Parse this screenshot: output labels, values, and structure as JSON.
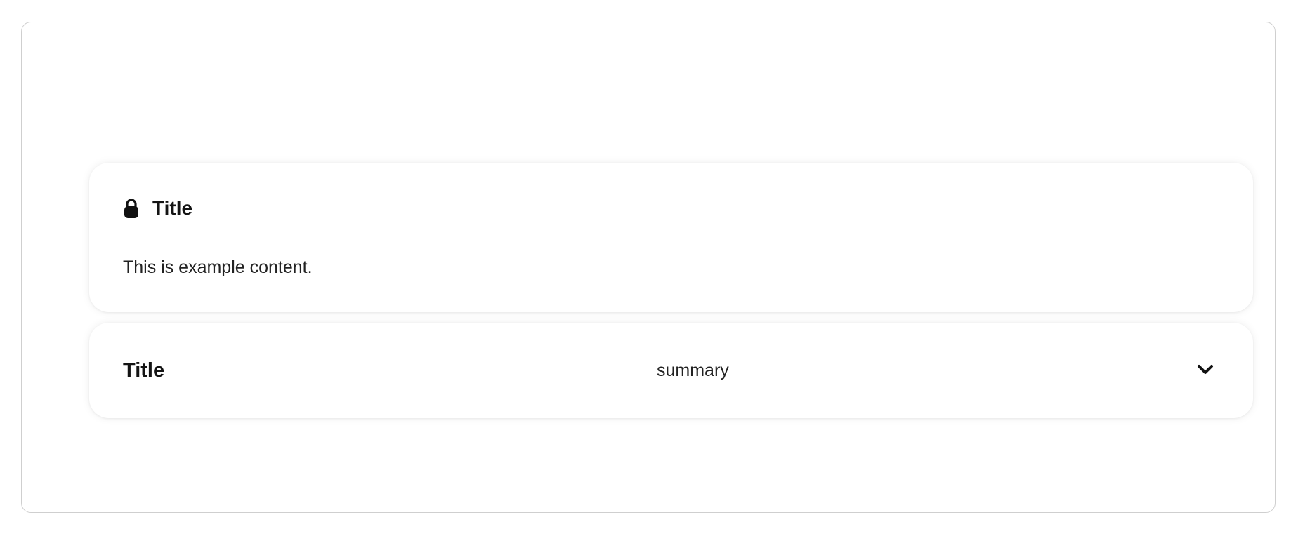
{
  "expanded_card": {
    "icon": "lock-icon",
    "title": "Title",
    "content": "This is example content."
  },
  "collapsed_card": {
    "title": "Title",
    "summary": "summary",
    "toggle_icon": "chevron-down-icon"
  }
}
